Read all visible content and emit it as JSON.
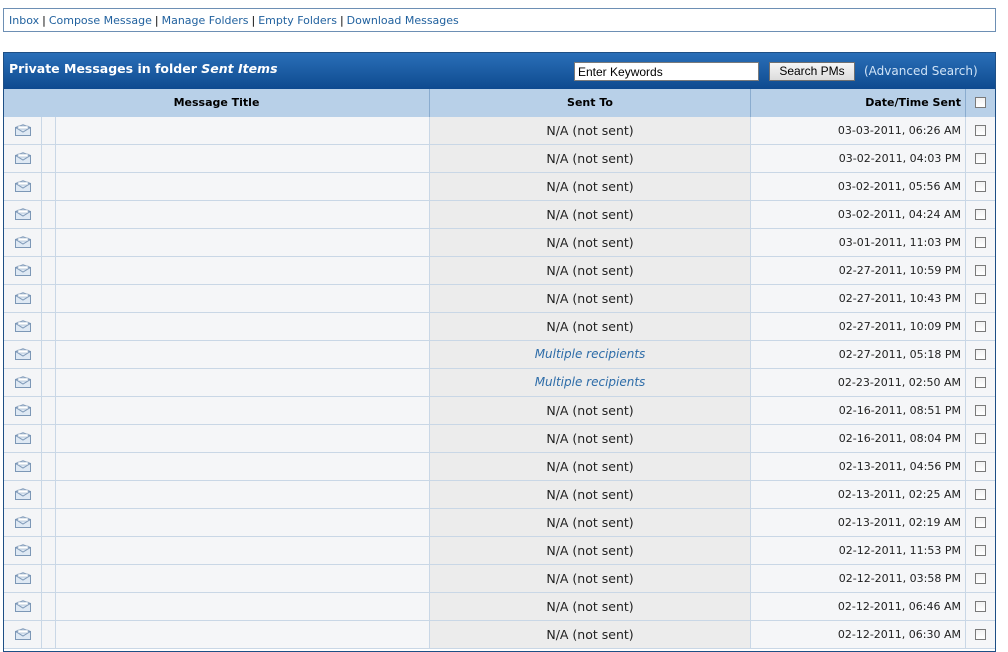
{
  "nav": {
    "links": [
      "Inbox",
      "Compose Message",
      "Manage Folders",
      "Empty Folders",
      "Download Messages"
    ],
    "separator": "|"
  },
  "header": {
    "title_prefix": "Private Messages in folder ",
    "folder_name": "Sent Items",
    "search_placeholder": "Enter Keywords",
    "search_button": "Search PMs",
    "advanced_search": "(Advanced Search)"
  },
  "columns": {
    "title": "Message Title",
    "sent_to": "Sent To",
    "date": "Date/Time Sent"
  },
  "rows": [
    {
      "sent_to": "N/A (not sent)",
      "date": "03-03-2011, 06:26 AM"
    },
    {
      "sent_to": "N/A (not sent)",
      "date": "03-02-2011, 04:03 PM"
    },
    {
      "sent_to": "N/A (not sent)",
      "date": "03-02-2011, 05:56 AM"
    },
    {
      "sent_to": "N/A (not sent)",
      "date": "03-02-2011, 04:24 AM"
    },
    {
      "sent_to": "N/A (not sent)",
      "date": "03-01-2011, 11:03 PM"
    },
    {
      "sent_to": "N/A (not sent)",
      "date": "02-27-2011, 10:59 PM"
    },
    {
      "sent_to": "N/A (not sent)",
      "date": "02-27-2011, 10:43 PM"
    },
    {
      "sent_to": "N/A (not sent)",
      "date": "02-27-2011, 10:09 PM"
    },
    {
      "sent_to": "Multiple recipients",
      "multi": true,
      "date": "02-27-2011, 05:18 PM"
    },
    {
      "sent_to": "Multiple recipients",
      "multi": true,
      "date": "02-23-2011, 02:50 AM"
    },
    {
      "sent_to": "N/A (not sent)",
      "date": "02-16-2011, 08:51 PM"
    },
    {
      "sent_to": "N/A (not sent)",
      "date": "02-16-2011, 08:04 PM"
    },
    {
      "sent_to": "N/A (not sent)",
      "date": "02-13-2011, 04:56 PM"
    },
    {
      "sent_to": "N/A (not sent)",
      "date": "02-13-2011, 02:25 AM"
    },
    {
      "sent_to": "N/A (not sent)",
      "date": "02-13-2011, 02:19 AM"
    },
    {
      "sent_to": "N/A (not sent)",
      "date": "02-12-2011, 11:53 PM"
    },
    {
      "sent_to": "N/A (not sent)",
      "date": "02-12-2011, 03:58 PM"
    },
    {
      "sent_to": "N/A (not sent)",
      "date": "02-12-2011, 06:46 AM"
    },
    {
      "sent_to": "N/A (not sent)",
      "date": "02-12-2011, 06:30 AM"
    }
  ],
  "icons": {
    "row_icon": "envelope-icon",
    "checkbox": "checkbox-icon"
  }
}
